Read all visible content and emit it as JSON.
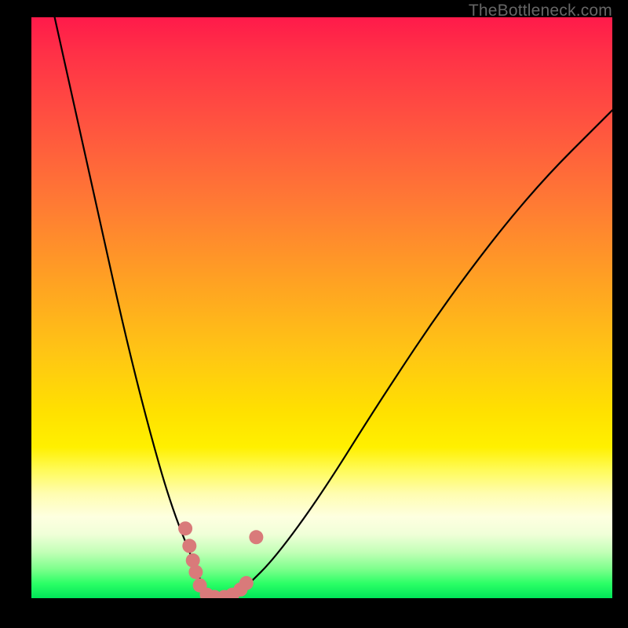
{
  "watermark": "TheBottleneck.com",
  "colors": {
    "background": "#000000",
    "gradient_top": "#ff1a4a",
    "gradient_bottom": "#00e558",
    "curve": "#000000",
    "markers": "#d97a7a"
  },
  "chart_data": {
    "type": "line",
    "title": "",
    "xlabel": "",
    "ylabel": "",
    "xlim": [
      0,
      100
    ],
    "ylim": [
      0,
      100
    ],
    "grid": false,
    "legend": false,
    "note": "V-shaped bottleneck curve; values estimated from pixels. x is horizontal fraction (%), y is bottleneck (%) — lower (toward green) is better.",
    "series": [
      {
        "name": "bottleneck-curve",
        "x": [
          4,
          8,
          12,
          16,
          20,
          24,
          28,
          29.5,
          31,
          33,
          35,
          37,
          42,
          50,
          60,
          72,
          86,
          100
        ],
        "y": [
          100,
          82,
          64,
          46,
          30,
          16,
          6,
          2,
          0,
          0,
          0.5,
          2,
          7,
          18,
          34,
          52,
          70,
          84
        ]
      }
    ],
    "markers": {
      "name": "highlighted-points",
      "note": "Pink dots cluster around the valley floor",
      "points": [
        {
          "x": 26.5,
          "y": 12
        },
        {
          "x": 27.2,
          "y": 9
        },
        {
          "x": 27.8,
          "y": 6.5
        },
        {
          "x": 28.3,
          "y": 4.5
        },
        {
          "x": 29.0,
          "y": 2.2
        },
        {
          "x": 30.2,
          "y": 0.6
        },
        {
          "x": 31.5,
          "y": 0.2
        },
        {
          "x": 33.2,
          "y": 0.2
        },
        {
          "x": 34.6,
          "y": 0.6
        },
        {
          "x": 36.0,
          "y": 1.5
        },
        {
          "x": 37.0,
          "y": 2.6
        },
        {
          "x": 38.7,
          "y": 10.5
        }
      ]
    }
  }
}
